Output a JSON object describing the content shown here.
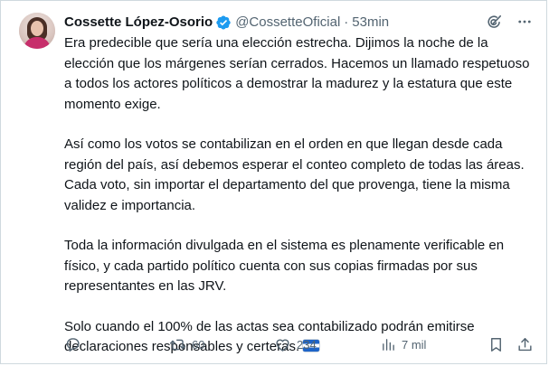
{
  "author": {
    "name": "Cossette López-Osorio",
    "handle": "@CossetteOficial",
    "separator": "·",
    "time": "53min"
  },
  "tweet": {
    "paragraphs": [
      "Era predecible que sería una elección estrecha. Dijimos la noche de la elección que los márgenes serían cerrados. Hacemos un llamado respetuoso a todos los actores políticos a demostrar la madurez y la estatura que este momento exige.",
      "Así como los votos se contabilizan en el orden en que llegan desde cada región del país, así debemos esperar el conteo completo de todas las áreas. Cada voto, sin importar el departamento del que provenga, tiene la misma validez e importancia.",
      "Toda la información divulgada en el sistema es plenamente verificable en físico, y cada partido político cuenta con sus copias firmadas por sus representantes en las JRV.",
      "Solo cuando el 100% de las actas sea contabilizado podrán emitirse declaraciones responsables y certeras."
    ],
    "flag_emoji": "honduras-flag"
  },
  "stats": {
    "replies": "",
    "retweets": "60",
    "likes": "234",
    "views": "7 mil"
  },
  "icons": {
    "verified": "verified-badge-icon",
    "grok": "grok-icon",
    "more": "more-icon",
    "reply": "reply-icon",
    "retweet": "retweet-icon",
    "like": "heart-icon",
    "views": "views-icon",
    "bookmark": "bookmark-icon",
    "share": "share-icon"
  },
  "colors": {
    "verified": "#1d9bf0",
    "text": "#0f1419",
    "secondary": "#536471"
  }
}
